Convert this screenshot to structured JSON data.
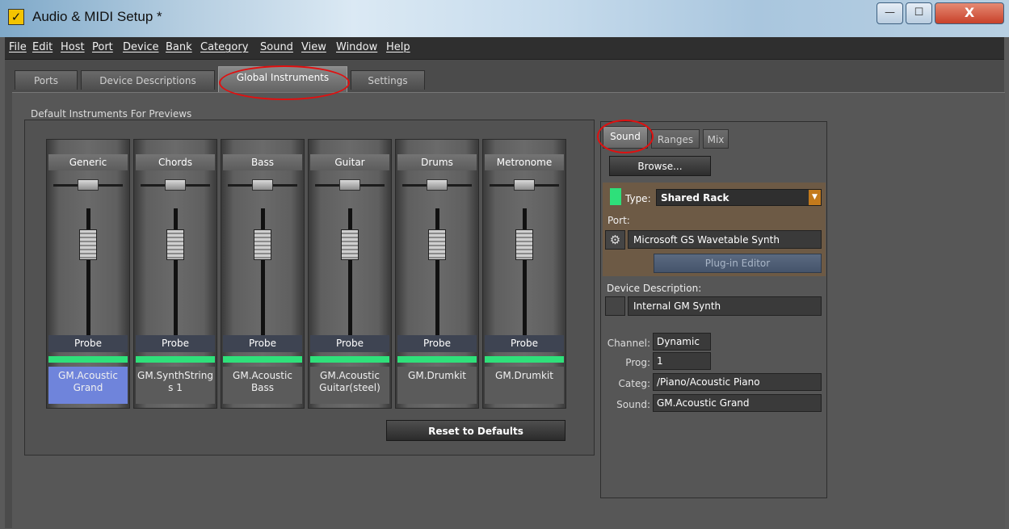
{
  "window": {
    "title": "Audio & MIDI Setup *",
    "minimize": "—",
    "maximize": "☐",
    "close": "X"
  },
  "menu": [
    "File",
    "Edit",
    "Host",
    "Port",
    "Device",
    "Bank",
    "Category",
    "Sound",
    "View",
    "Window",
    "Help"
  ],
  "tabs": [
    "Ports",
    "Device Descriptions",
    "Global Instruments",
    "Settings"
  ],
  "group_label": "Default Instruments For Previews",
  "strips": [
    {
      "name": "Generic",
      "probe": "Probe",
      "instrument": "GM.Acoustic Grand"
    },
    {
      "name": "Chords",
      "probe": "Probe",
      "instrument": "GM.SynthString s 1"
    },
    {
      "name": "Bass",
      "probe": "Probe",
      "instrument": "GM.Acoustic Bass"
    },
    {
      "name": "Guitar",
      "probe": "Probe",
      "instrument": "GM.Acoustic Guitar(steel)"
    },
    {
      "name": "Drums",
      "probe": "Probe",
      "instrument": "GM.Drumkit"
    },
    {
      "name": "Metronome",
      "probe": "Probe",
      "instrument": "GM.Drumkit"
    }
  ],
  "reset_label": "Reset to Defaults",
  "right_tabs": [
    "Sound",
    "Ranges",
    "Mix"
  ],
  "browse_label": "Browse...",
  "type": {
    "label": "Type:",
    "value": "Shared Rack"
  },
  "port": {
    "label": "Port:",
    "value": "Microsoft GS Wavetable Synth",
    "plugin_label": "Plug-in Editor"
  },
  "device_description": {
    "label": "Device Description:",
    "value": "Internal GM Synth"
  },
  "fields": {
    "channel": {
      "label": "Channel:",
      "value": "Dynamic"
    },
    "prog": {
      "label": "Prog:",
      "value": "1"
    },
    "categ": {
      "label": "Categ:",
      "value": "/Piano/Acoustic Piano"
    },
    "sound": {
      "label": "Sound:",
      "value": "GM.Acoustic Grand"
    }
  },
  "colors": {
    "meter": "#2fe07a",
    "selected_instrument": "#6f84db",
    "type_swatch": "#2ee07a"
  }
}
